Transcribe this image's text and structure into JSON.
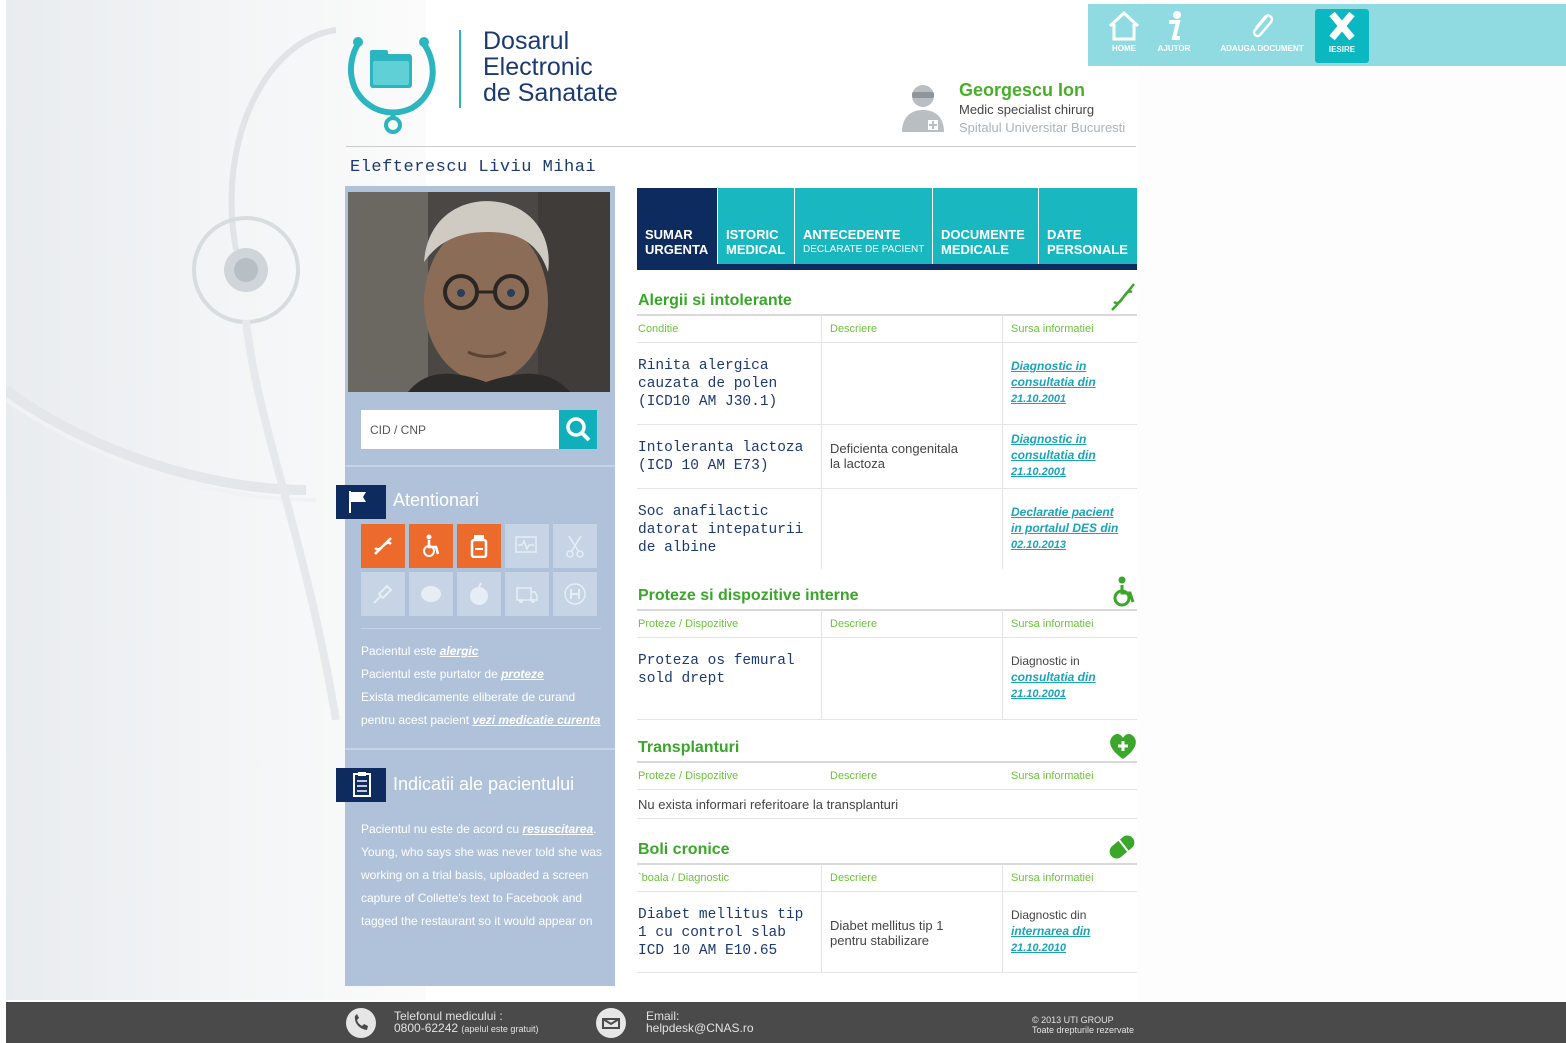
{
  "app": {
    "title_lines": [
      "Dosarul",
      "Electronic",
      "de Sanatate"
    ]
  },
  "toolbar": {
    "home": "HOME",
    "help": "AJUTOR",
    "add_document": "ADAUGA DOCUMENT",
    "exit": "IESIRE"
  },
  "doctor": {
    "name": "Georgescu Ion",
    "role": "Medic specialist chirurg",
    "hospital": "Spitalul Universitar Bucuresti"
  },
  "patient": {
    "name": "Elefterescu Liviu Mihai"
  },
  "search": {
    "placeholder": "CID / CNP"
  },
  "alerts": {
    "title": "Atentionari",
    "line1_prefix": "Pacientul este ",
    "line1_link": "alergic",
    "line2_prefix": "Pacientul este purtator de ",
    "line2_link": "proteze",
    "line3": "Exista medicamente eliberate de curand",
    "line4_prefix": "pentru acest pacient ",
    "line4_link": "vezi medicatie curenta"
  },
  "indications": {
    "title": "Indicatii ale pacientului",
    "prefix": "Pacientul nu este de acord cu ",
    "link": "resuscitarea",
    "suffix": ".",
    "lines": [
      "Young, who says she was never told she was",
      "working on a trial basis, uploaded a screen",
      "capture of Collette's text to Facebook and",
      "tagged the restaurant so it would appear on"
    ]
  },
  "tabs": [
    {
      "line1": "SUMAR",
      "line2": "URGENTA"
    },
    {
      "line1": "ISTORIC",
      "line2": "MEDICAL"
    },
    {
      "line1": "ANTECEDENTE",
      "line2": "DECLARATE DE PACIENT"
    },
    {
      "line1": "DOCUMENTE",
      "line2": "MEDICALE"
    },
    {
      "line1": "DATE",
      "line2": "PERSONALE"
    }
  ],
  "allergies": {
    "title": "Alergii si intolerante",
    "columns": [
      "Conditie",
      "Descriere",
      "Sursa informatiei"
    ],
    "rows": [
      {
        "condition": [
          "Rinita alergica",
          "cauzata de polen",
          "(ICD10 AM J30.1)"
        ],
        "description": [],
        "source": [
          "Diagnostic in",
          "consultatia din",
          "21.10.2001"
        ]
      },
      {
        "condition": [
          "Intoleranta lactoza",
          "(ICD 10 AM E73)"
        ],
        "description": [
          "Deficienta congenitala",
          "la lactoza"
        ],
        "source": [
          "Diagnostic in",
          "consultatia din",
          "21.10.2001"
        ]
      },
      {
        "condition": [
          "Soc anafilactic",
          "datorat intepaturii",
          "de albine"
        ],
        "description": [],
        "source": [
          "Declaratie pacient",
          "in portalul DES din",
          "02.10.2013"
        ]
      }
    ]
  },
  "prostheses": {
    "title": "Proteze si dispozitive interne",
    "columns": [
      "Proteze / Dispozitive",
      "Descriere",
      "Sursa informatiei"
    ],
    "rows": [
      {
        "condition": [
          "Proteza os femural",
          "sold drept"
        ],
        "description": [],
        "source": [
          "Diagnostic in",
          "consultatia din",
          "21.10.2001"
        ]
      }
    ]
  },
  "transplants": {
    "title": "Transplanturi",
    "columns": [
      "Proteze / Dispozitive",
      "Descriere",
      "Sursa informatiei"
    ],
    "empty_message": "Nu exista informari referitoare la transplanturi"
  },
  "chronic": {
    "title": "Boli cronice",
    "columns": [
      "`boala / Diagnostic",
      "Descriere",
      "Sursa informatiei"
    ],
    "rows": [
      {
        "condition": [
          "Diabet mellitus tip",
          "1 cu control slab",
          "ICD 10 AM E10.65"
        ],
        "description": [
          "Diabet mellitus tip 1",
          "pentru stabilizare"
        ],
        "source": [
          "Diagnostic din",
          "internarea din",
          "21.10.2010"
        ]
      }
    ]
  },
  "footer": {
    "phone_label": "Telefonul medicului :",
    "phone_number": "0800-62242",
    "phone_note": "(apelul este gratuit)",
    "email_label": "Email:",
    "email": "helpdesk@CNAS.ro",
    "copyright": "© 2013 UTI GROUP",
    "rights": "Toate drepturile rezervate"
  },
  "colors": {
    "navy": "#0d2b5e",
    "teal": "#19b8c0",
    "green": "#3aa62a",
    "orange": "#ec6a2c",
    "panel": "#b0c2da"
  }
}
